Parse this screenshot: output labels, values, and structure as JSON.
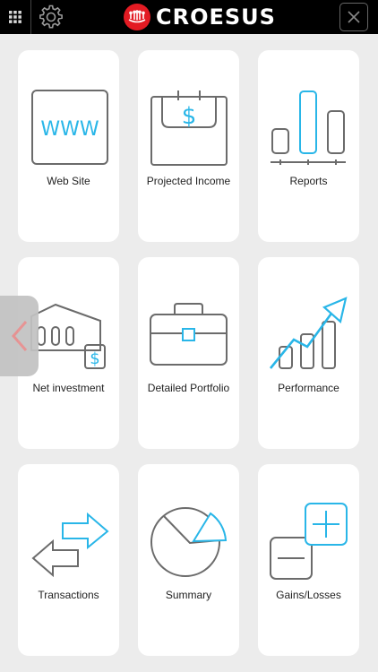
{
  "header": {
    "brand": "CROESUS",
    "menu_icon": "grid-menu-icon",
    "settings_icon": "gear-icon",
    "close_icon": "close-icon"
  },
  "colors": {
    "accent": "#29b6e8",
    "icon_stroke": "#6b6b6b",
    "brand_red": "#e31b23",
    "back_arrow": "#e58b8b"
  },
  "tiles": [
    {
      "label": "Web Site",
      "icon": "www-icon",
      "icon_text": "WWW"
    },
    {
      "label": "Projected Income",
      "icon": "calendar-dollar-icon",
      "icon_text": "$"
    },
    {
      "label": "Reports",
      "icon": "bar-chart-icon"
    },
    {
      "label": "Net investment",
      "icon": "bank-dollar-icon",
      "icon_text": "$"
    },
    {
      "label": "Detailed Portfolio",
      "icon": "briefcase-icon"
    },
    {
      "label": "Performance",
      "icon": "growth-chart-icon"
    },
    {
      "label": "Transactions",
      "icon": "transfer-arrows-icon"
    },
    {
      "label": "Summary",
      "icon": "pie-chart-icon"
    },
    {
      "label": "Gains/Losses",
      "icon": "plus-minus-icon"
    }
  ],
  "side": {
    "back_icon": "chevron-left-icon"
  }
}
